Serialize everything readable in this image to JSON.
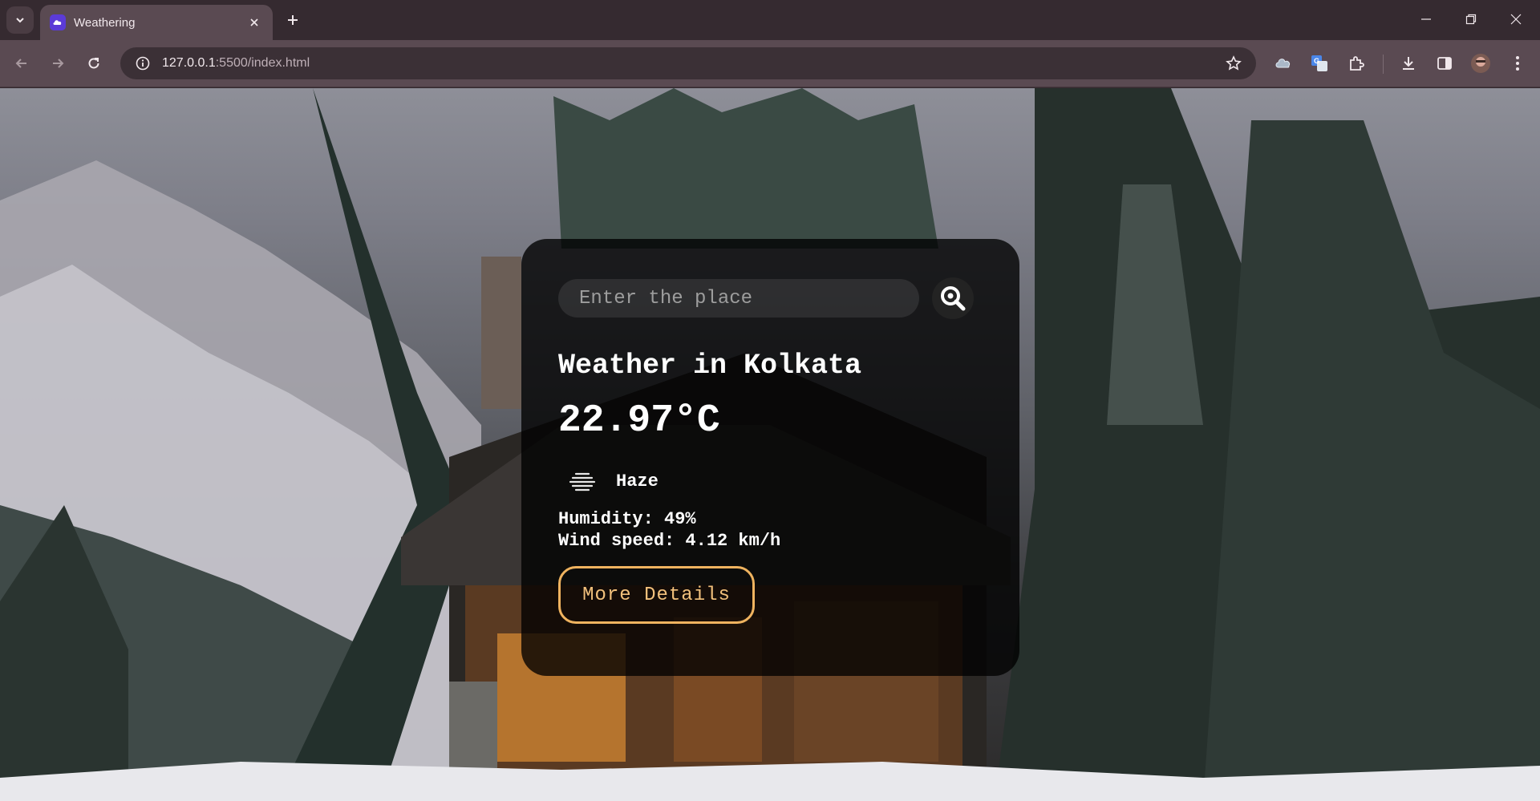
{
  "browser": {
    "tab_title": "Weathering",
    "url_host": "127.0.0.1",
    "url_rest": ":5500/index.html"
  },
  "weather": {
    "search_placeholder": "Enter the place",
    "city": "Weather in Kolkata",
    "temperature": "22.97°C",
    "description": "Haze",
    "humidity": "Humidity: 49%",
    "wind": "Wind speed: 4.12 km/h",
    "more_button": "More Details"
  },
  "colors": {
    "accent": "#efb35f",
    "tab_favicon": "#5b3bd6",
    "chrome_bg": "#352a30",
    "toolbar_bg": "#5a4a52"
  },
  "icons": {
    "search": "magnifier-icon",
    "weather": "haze-icon"
  }
}
